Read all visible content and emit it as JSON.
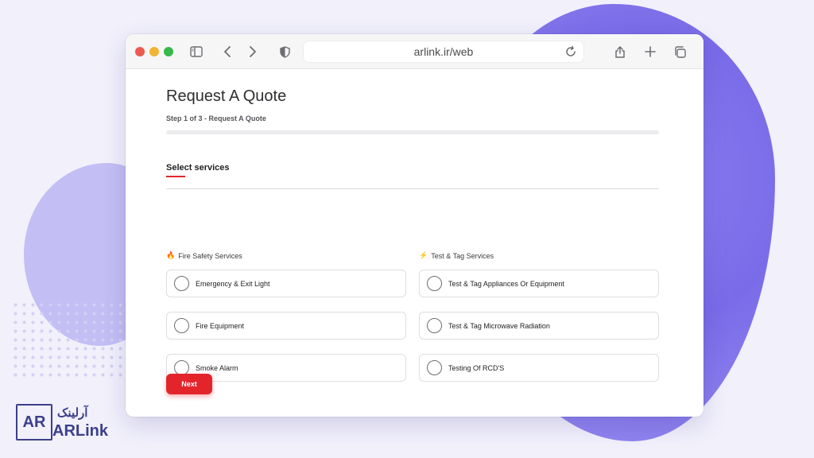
{
  "browser": {
    "url": "arlink.ir/web"
  },
  "form": {
    "title": "Request A Quote",
    "step": "Step 1 of 3 - Request A Quote",
    "progress_fraction": 0,
    "section_title": "Select services",
    "groups": [
      {
        "heading": "Fire Safety Services",
        "icon": "fire-icon",
        "options": [
          "Emergency & Exit Light",
          "Fire Equipment",
          "Smoke Alarm"
        ]
      },
      {
        "heading": "Test & Tag Services",
        "icon": "lightning-icon",
        "options": [
          "Test & Tag Appliances Or Equipment",
          "Test & Tag Microwave Radiation",
          "Testing Of RCD'S"
        ]
      }
    ],
    "next_label": "Next"
  },
  "brand": {
    "logo_box": "AR",
    "name_fa": "آرلینک",
    "name_en": "ARLink"
  },
  "colors": {
    "accent": "#e3252b",
    "brand": "#3c3f8a",
    "background": "#f1f0fb"
  }
}
